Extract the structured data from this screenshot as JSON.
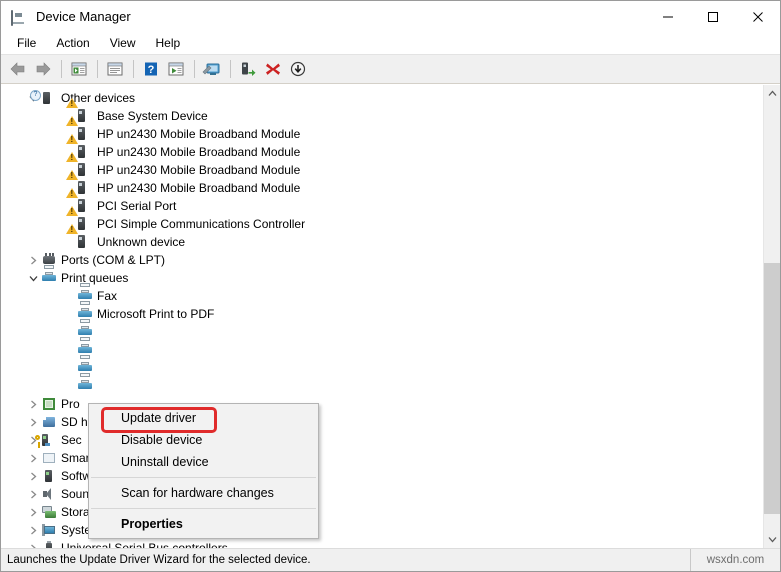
{
  "window": {
    "title": "Device Manager",
    "icon": "device-manager-icon",
    "controls": {
      "minimize": "—",
      "maximize": "□",
      "close": "✕"
    }
  },
  "menubar": {
    "items": [
      {
        "label": "File",
        "name": "menu-file"
      },
      {
        "label": "Action",
        "name": "menu-action"
      },
      {
        "label": "View",
        "name": "menu-view"
      },
      {
        "label": "Help",
        "name": "menu-help"
      }
    ]
  },
  "toolbar": {
    "buttons": [
      {
        "name": "back-icon",
        "glyph": "←"
      },
      {
        "name": "forward-icon",
        "glyph": "→"
      },
      {
        "name": "show-hide-console-tree-icon",
        "glyph": "▤"
      },
      {
        "name": "properties-icon",
        "glyph": "▥"
      },
      {
        "name": "help-icon",
        "glyph": "?"
      },
      {
        "name": "update-driver-icon",
        "glyph": "▶"
      },
      {
        "name": "scan-for-hardware-changes-icon",
        "glyph": "Ὓ5"
      },
      {
        "name": "enable-device-icon",
        "glyph": "▮"
      },
      {
        "name": "uninstall-device-icon",
        "glyph": "✕"
      },
      {
        "name": "install-legacy-hardware-icon",
        "glyph": "↓"
      }
    ]
  },
  "tree": {
    "rows": [
      {
        "label": "Other devices",
        "icon": "other-devices-icon",
        "indent": 1,
        "twisty": "open",
        "selected": false
      },
      {
        "label": "Base System Device",
        "icon": "warning-device-icon",
        "indent": 2,
        "twisty": "none",
        "selected": false
      },
      {
        "label": "HP un2430 Mobile Broadband Module",
        "icon": "warning-device-icon",
        "indent": 2,
        "twisty": "none",
        "selected": false
      },
      {
        "label": "HP un2430 Mobile Broadband Module",
        "icon": "warning-device-icon",
        "indent": 2,
        "twisty": "none",
        "selected": false
      },
      {
        "label": "HP un2430 Mobile Broadband Module",
        "icon": "warning-device-icon",
        "indent": 2,
        "twisty": "none",
        "selected": false
      },
      {
        "label": "HP un2430 Mobile Broadband Module",
        "icon": "warning-device-icon",
        "indent": 2,
        "twisty": "none",
        "selected": false
      },
      {
        "label": "PCI Serial Port",
        "icon": "warning-device-icon",
        "indent": 2,
        "twisty": "none",
        "selected": false
      },
      {
        "label": "PCI Simple Communications Controller",
        "icon": "warning-device-icon",
        "indent": 2,
        "twisty": "none",
        "selected": false
      },
      {
        "label": "Unknown device",
        "icon": "warning-device-icon",
        "indent": 2,
        "twisty": "none",
        "selected": false
      },
      {
        "label": "Ports (COM & LPT)",
        "icon": "ports-icon",
        "indent": 1,
        "twisty": "closed",
        "selected": false
      },
      {
        "label": "Print queues",
        "icon": "printer-icon",
        "indent": 1,
        "twisty": "open",
        "selected": false
      },
      {
        "label": "Fax",
        "icon": "printer-icon",
        "indent": 2,
        "twisty": "none",
        "selected": false
      },
      {
        "label": "Microsoft Print to PDF",
        "icon": "printer-icon",
        "indent": 2,
        "twisty": "none",
        "selected": false
      },
      {
        "label": "",
        "icon": "printer-icon",
        "indent": 2,
        "twisty": "none",
        "selected": true
      },
      {
        "label": "",
        "icon": "printer-icon",
        "indent": 2,
        "twisty": "none",
        "selected": false
      },
      {
        "label": "",
        "icon": "printer-icon",
        "indent": 2,
        "twisty": "none",
        "selected": false
      },
      {
        "label": "",
        "icon": "printer-icon",
        "indent": 2,
        "twisty": "none",
        "selected": false
      },
      {
        "label": "Pro",
        "icon": "processor-icon",
        "indent": 1,
        "twisty": "closed",
        "selected": false
      },
      {
        "label": "SD h",
        "icon": "sd-host-icon",
        "indent": 1,
        "twisty": "closed",
        "selected": false
      },
      {
        "label": "Sec",
        "icon": "security-device-icon",
        "indent": 1,
        "twisty": "closed",
        "selected": false
      },
      {
        "label": "Smart card readers",
        "icon": "smart-card-icon",
        "indent": 1,
        "twisty": "closed",
        "selected": false
      },
      {
        "label": "Software devices",
        "icon": "software-device-icon",
        "indent": 1,
        "twisty": "closed",
        "selected": false
      },
      {
        "label": "Sound, video and game controllers",
        "icon": "sound-icon",
        "indent": 1,
        "twisty": "closed",
        "selected": false
      },
      {
        "label": "Storage controllers",
        "icon": "storage-icon",
        "indent": 1,
        "twisty": "closed",
        "selected": false
      },
      {
        "label": "System devices",
        "icon": "system-devices-icon",
        "indent": 1,
        "twisty": "closed",
        "selected": false
      },
      {
        "label": "Universal Serial Bus controllers",
        "icon": "usb-icon",
        "indent": 1,
        "twisty": "closed",
        "selected": false
      }
    ]
  },
  "context_menu": {
    "items": [
      {
        "label": "Update driver",
        "name": "ctx-update-driver",
        "bold": false,
        "highlighted": true,
        "separator_before": false
      },
      {
        "label": "Disable device",
        "name": "ctx-disable-device",
        "bold": false,
        "highlighted": false,
        "separator_before": false
      },
      {
        "label": "Uninstall device",
        "name": "ctx-uninstall-device",
        "bold": false,
        "highlighted": false,
        "separator_before": false
      },
      {
        "label": "Scan for hardware changes",
        "name": "ctx-scan-hardware",
        "bold": false,
        "highlighted": false,
        "separator_before": true
      },
      {
        "label": "Properties",
        "name": "ctx-properties",
        "bold": true,
        "highlighted": false,
        "separator_before": true
      }
    ],
    "highlight_color": "#e02b2b"
  },
  "statusbar": {
    "message": "Launches the Update Driver Wizard for the selected device.",
    "watermark": "wsxdn.com"
  },
  "scrollbar": {
    "up_arrow": "∧",
    "down_arrow": "∨"
  }
}
